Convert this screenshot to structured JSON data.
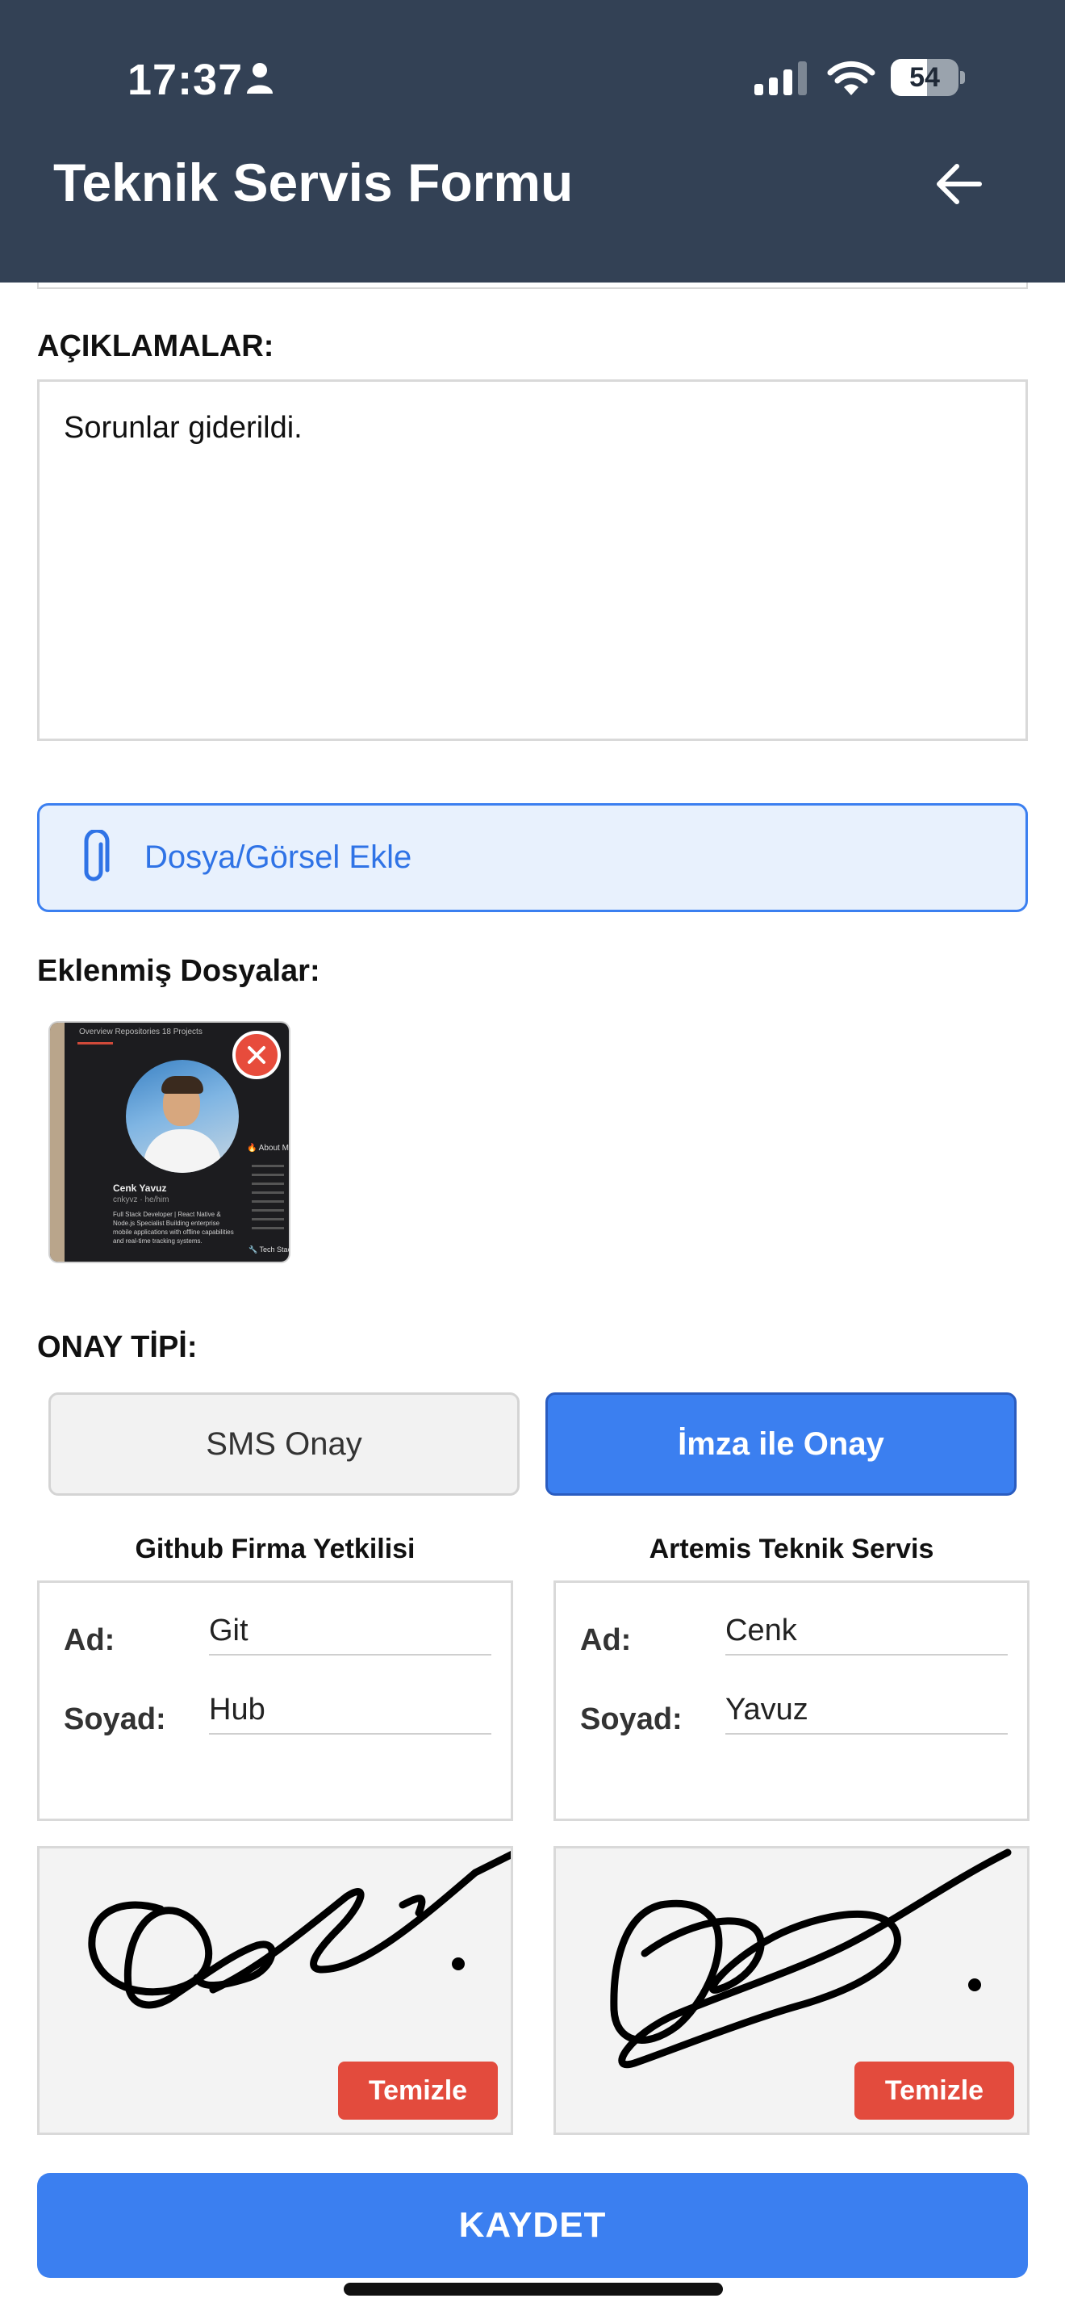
{
  "status_bar": {
    "time": "17:37",
    "battery": "54",
    "battery_level": 0.54,
    "icons": [
      "person-icon",
      "signal-icon",
      "wifi-icon",
      "battery-icon"
    ]
  },
  "header": {
    "title": "Teknik Servis Formu",
    "back_icon": "arrow-left-icon"
  },
  "colors": {
    "header_bg": "#334155",
    "primary": "#3b7ff0",
    "danger": "#e34b3d"
  },
  "description": {
    "label": "AÇIKLAMALAR:",
    "value": "Sorunlar giderildi."
  },
  "attachments": {
    "add_label": "Dosya/Görsel Ekle",
    "add_icon": "paperclip-icon",
    "list_label": "Eklenmiş Dosyalar:",
    "thumbnail": {
      "tabs": "Overview   Repositories 18   Projects",
      "name": "Cenk Yavuz",
      "handle": "cnkyvz · he/him",
      "bio": "Full Stack Developer | React Native & Node.js Specialist Building enterprise mobile applications with offline capabilities and real-time tracking systems.",
      "side_title": "🔥 About M",
      "tech": "🔧 Tech Stack"
    }
  },
  "approval": {
    "label": "ONAY TİPİ:",
    "options": [
      "SMS Onay",
      "İmza ile Onay"
    ],
    "selected": "İmza ile Onay"
  },
  "parties": [
    {
      "title": "Github Firma Yetkilisi",
      "ad_label": "Ad:",
      "ad": "Git",
      "soyad_label": "Soyad:",
      "soyad": "Hub",
      "clear_label": "Temizle"
    },
    {
      "title": "Artemis Teknik Servis",
      "ad_label": "Ad:",
      "ad": "Cenk",
      "soyad_label": "Soyad:",
      "soyad": "Yavuz",
      "clear_label": "Temizle"
    }
  ],
  "save_label": "KAYDET"
}
